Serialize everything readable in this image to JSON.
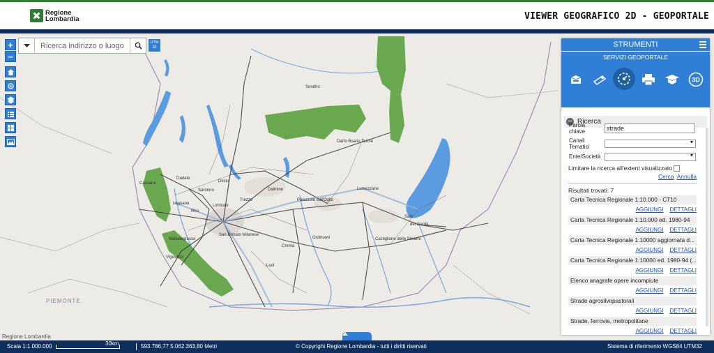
{
  "header": {
    "logo_line1": "Regione",
    "logo_line2": "Lombardia",
    "title": "VIEWER GEOGRAFICO 2D - GEOPORTALE"
  },
  "map_controls": {
    "zoom_in": "+",
    "zoom_out": "−",
    "search_placeholder": "Ricerca indirizzo o luogo",
    "utm_line1": "UTM",
    "utm_line2": "32"
  },
  "map_labels": {
    "piemonte": "PIEMONTE",
    "darfo": "Darfo Boario Terme",
    "lumezzane": "Lumezzane",
    "palazzolo": "Palazzolo sull'Oglio",
    "orzinuovi": "Orzinuovi",
    "crema": "Crema",
    "dalmine": "Dalmine",
    "trezzo": "Trezzo",
    "castiglione": "Castiglione delle Stiviere",
    "vigevano": "Vigevano",
    "abbiategrasso": "Abbiategrasso",
    "legnano": "Legnano",
    "saronno": "Saronno",
    "cassano": "Cassano",
    "desio": "Desio",
    "lodi": "Lodi",
    "sondrio": "Sondrio",
    "salo": "Salò",
    "desenzano": "del Garda",
    "san_donato": "San Donato Milanese",
    "tradate": "Tradate",
    "rho": "Rho",
    "limbiate": "Limbiate"
  },
  "attribution": "Regione Lombardia",
  "panel": {
    "title": "STRUMENTI",
    "subtitle": "SERVIZI GEOPORTALE",
    "tools": [
      "layers-tool-icon",
      "measure-tool-icon",
      "search-tool-icon",
      "print-tool-icon",
      "catalog-tool-icon",
      "3d-tool-icon"
    ],
    "tool_3d_label": "3D",
    "section_title": "Ricerca",
    "form": {
      "keyword_label": "Parola chiave",
      "keyword_value": "strade",
      "channels_label": "Canali Tematici",
      "entity_label": "Ente/Società",
      "limit_label": "Limitare la ricerca all'extent visualizzato",
      "search_link": "Cerca",
      "cancel_link": "Annulla"
    },
    "results_count": "Risultati trovati: 7",
    "add_label": "AGGIUNGI",
    "details_label": "DETTAGLI",
    "results": [
      {
        "title": "Carta Tecnica Regionale 1:10.000 - CT10"
      },
      {
        "title": "Carta Tecnica Regionale 1:10.000 ed. 1980-94"
      },
      {
        "title": "Carta Tecnica Regionale 1:10000 aggiornata d..."
      },
      {
        "title": "Carta Tecnica Regionale 1:10000 ed. 1980-94 (..."
      },
      {
        "title": "Elenco anagrafe opere incompiute"
      },
      {
        "title": "Strade agrosilvopastorali"
      },
      {
        "title": "Strade, ferrovie, metropolitane"
      }
    ]
  },
  "footer": {
    "scale": "Scala 1:1.000.000",
    "scale_bar_label": "30km",
    "coords": "593.786,77 5.062.363,80 Metri",
    "copyright": "© Copyright Regione Lombardia - tutti i diritti riservati",
    "crs": "Sistema di riferimento WGS84 UTM32"
  },
  "colors": {
    "header_green": "#2e7d32",
    "nav_blue": "#0e2e5c",
    "tool_blue": "#2f7fd6",
    "park_green": "#6aa84f",
    "lake_blue": "#5b9be0"
  }
}
